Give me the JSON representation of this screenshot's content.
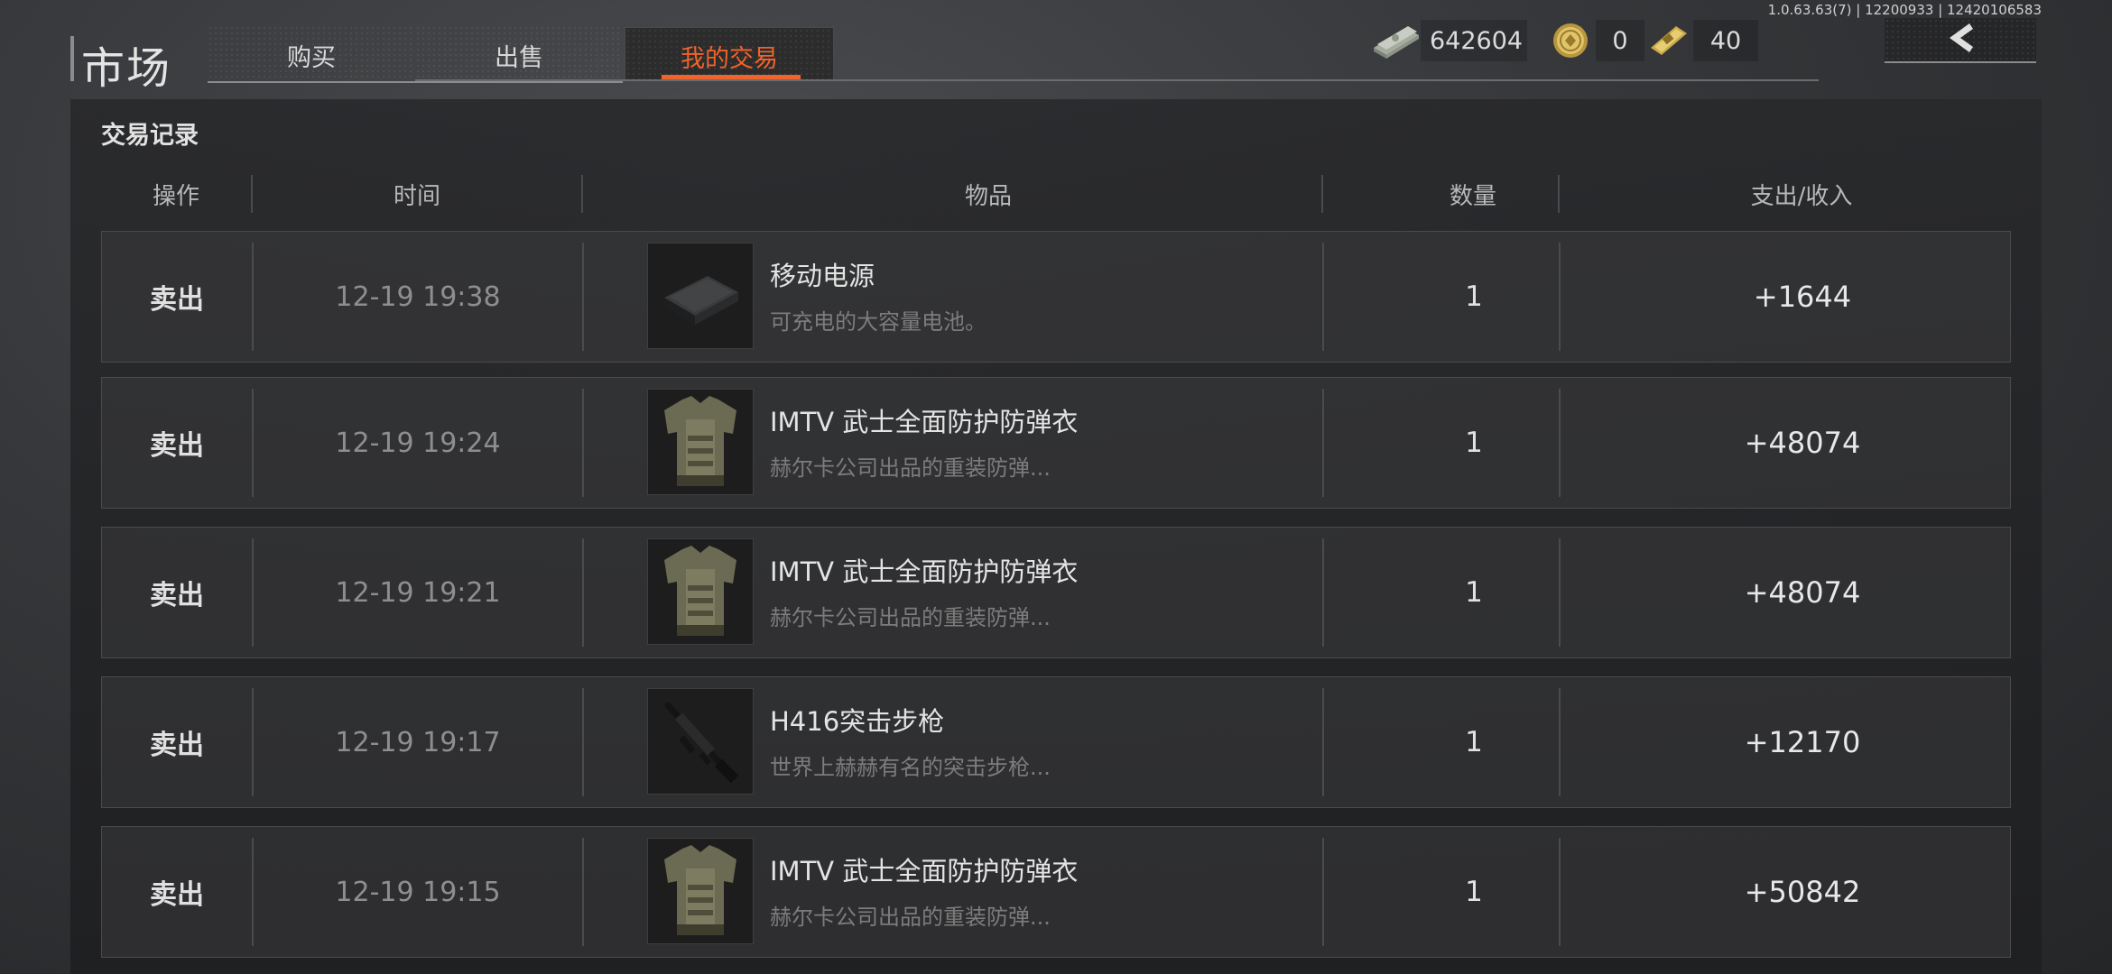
{
  "version": "1.0.63.63(7) | 12200933 | 12420106583",
  "header": {
    "title": "市场",
    "tabs": [
      {
        "label": "购买",
        "active": false
      },
      {
        "label": "出售",
        "active": false
      },
      {
        "label": "我的交易",
        "active": true
      }
    ]
  },
  "currency": {
    "cash": "642604",
    "coin": "0",
    "ticket": "40"
  },
  "panel": {
    "title": "交易记录",
    "columns": [
      "操作",
      "时间",
      "物品",
      "数量",
      "支出/收入"
    ]
  },
  "rows": [
    {
      "op": "卖出",
      "time": "12-19 19:38",
      "name": "移动电源",
      "desc": "可充电的大容量电池。",
      "icon": "power-bank-icon",
      "qty": "1",
      "amount": "+1644"
    },
    {
      "op": "卖出",
      "time": "12-19 19:24",
      "name": "IMTV 武士全面防护防弹衣",
      "desc": "赫尔卡公司出品的重装防弹...",
      "icon": "body-armor-icon",
      "qty": "1",
      "amount": "+48074"
    },
    {
      "op": "卖出",
      "time": "12-19 19:21",
      "name": "IMTV 武士全面防护防弹衣",
      "desc": "赫尔卡公司出品的重装防弹...",
      "icon": "body-armor-icon",
      "qty": "1",
      "amount": "+48074"
    },
    {
      "op": "卖出",
      "time": "12-19 19:17",
      "name": "H416突击步枪",
      "desc": "世界上赫赫有名的突击步枪...",
      "icon": "assault-rifle-icon",
      "qty": "1",
      "amount": "+12170"
    },
    {
      "op": "卖出",
      "time": "12-19 19:15",
      "name": "IMTV 武士全面防护防弹衣",
      "desc": "赫尔卡公司出品的重装防弹...",
      "icon": "body-armor-icon",
      "qty": "1",
      "amount": "+50842"
    }
  ],
  "colors": {
    "accent": "#f0632b",
    "background": "#35373a"
  }
}
